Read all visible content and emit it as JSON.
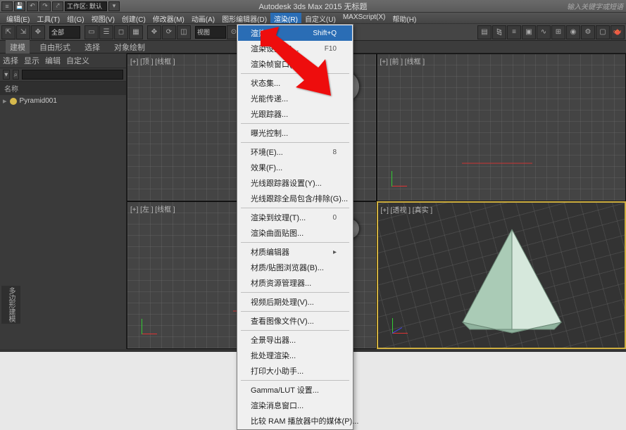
{
  "title": "Autodesk 3ds Max 2015   无标题",
  "searchHint": "输入关键字或短语",
  "workspace": "工作区: 默认",
  "menu": {
    "edit": "编辑(E)",
    "tools": "工具(T)",
    "group": "组(G)",
    "view": "视图(V)",
    "create": "创建(C)",
    "modifiers": "修改器(M)",
    "animation": "动画(A)",
    "graph": "图形编辑器(D)",
    "render": "渲染(R)",
    "custom": "自定义(U)",
    "maxscript": "MAXScript(X)",
    "help": "帮助(H)"
  },
  "ribbon": {
    "tab0": "建模",
    "tab1": "自由形式",
    "tab2": "选择",
    "tab3": "对象绘制",
    "side": "多边形建模"
  },
  "combo": {
    "all": "全部",
    "view": "视图"
  },
  "scene": {
    "tabs": {
      "select": "选择",
      "display": "显示",
      "edit": "编辑",
      "custom": "自定义"
    },
    "nameHeader": "名称",
    "object": "Pyramid001"
  },
  "viewports": {
    "tl": "[+] [顶 ] [线框 ]",
    "tr": "[+] [前 ] [线框 ]",
    "bl": "[+] [左 ] [线框 ]",
    "br": "[+] [透视 ] [真实 ]"
  },
  "dropdown": [
    {
      "label": "渲染",
      "shortcut": "Shift+Q",
      "hl": true
    },
    {
      "label": "渲染设置(R)...",
      "shortcut": "F10"
    },
    {
      "label": "渲染帧窗口(W)..."
    },
    {
      "sep": true
    },
    {
      "label": "状态集..."
    },
    {
      "label": "光能传递..."
    },
    {
      "label": "光跟踪器..."
    },
    {
      "sep": true
    },
    {
      "label": "曝光控制..."
    },
    {
      "sep": true
    },
    {
      "label": "环境(E)...",
      "shortcut": "8"
    },
    {
      "label": "效果(F)..."
    },
    {
      "label": "光线跟踪器设置(Y)..."
    },
    {
      "label": "光线跟踪全局包含/排除(G)..."
    },
    {
      "sep": true
    },
    {
      "label": "渲染到纹理(T)...",
      "shortcut": "0"
    },
    {
      "label": "渲染曲面贴图..."
    },
    {
      "sep": true
    },
    {
      "label": "材质编辑器",
      "arrow": true
    },
    {
      "label": "材质/贴图浏览器(B)..."
    },
    {
      "label": "材质资源管理器..."
    },
    {
      "sep": true
    },
    {
      "label": "视频后期处理(V)..."
    },
    {
      "sep": true
    },
    {
      "label": "查看图像文件(V)..."
    },
    {
      "sep": true
    },
    {
      "label": "全景导出器..."
    },
    {
      "label": "批处理渲染..."
    },
    {
      "label": "打印大小助手..."
    },
    {
      "sep": true
    },
    {
      "label": "Gamma/LUT 设置..."
    },
    {
      "label": "渲染消息窗口..."
    },
    {
      "label": "比较 RAM 播放器中的媒体(P)..."
    }
  ]
}
